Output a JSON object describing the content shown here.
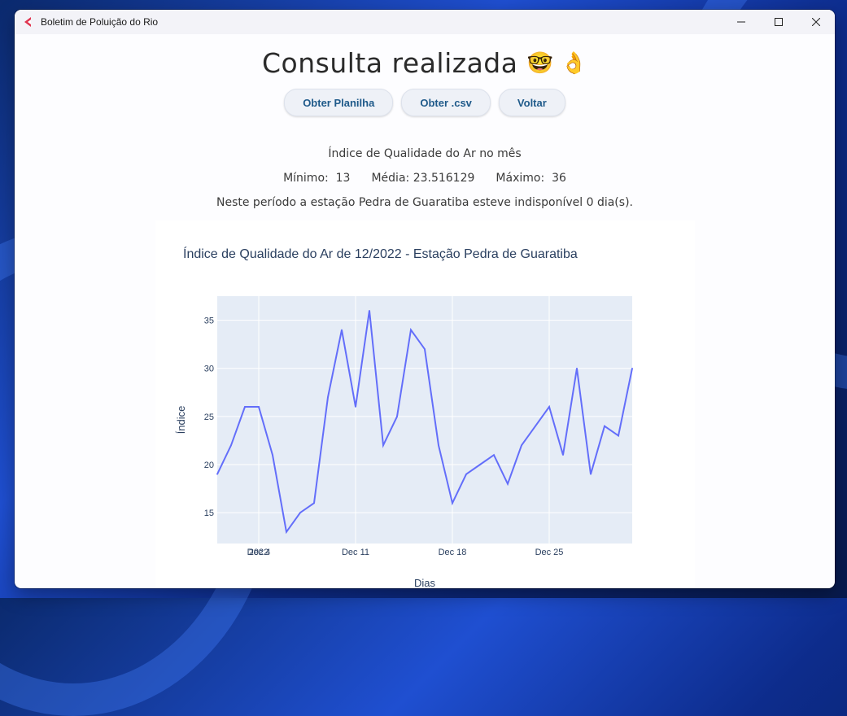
{
  "window": {
    "title": "Boletim de Poluição do Rio",
    "controls": [
      "minimize",
      "maximize",
      "close"
    ]
  },
  "page": {
    "heading": "Consulta realizada",
    "heading_emojis": "🤓 👌",
    "buttons": {
      "spreadsheet": "Obter Planilha",
      "csv": "Obter .csv",
      "back": "Voltar"
    },
    "subtitle": "Índice de Qualidade do Ar no mês",
    "stats": {
      "min_label": "Mínimo:",
      "min_value": "13",
      "avg_label": "Média:",
      "avg_value": "23.516129",
      "max_label": "Máximo:",
      "max_value": "36"
    },
    "unavailable_text": "Neste período a estação Pedra de Guaratiba esteve indisponível  0 dia(s)."
  },
  "chart_data": {
    "type": "line",
    "title": "Índice de Qualidade do Ar de 12/2022 - Estação Pedra de Guaratiba",
    "xlabel": "Dias",
    "ylabel": "Índice",
    "x": [
      "2022-12-01",
      "2022-12-02",
      "2022-12-03",
      "2022-12-04",
      "2022-12-05",
      "2022-12-06",
      "2022-12-07",
      "2022-12-08",
      "2022-12-09",
      "2022-12-10",
      "2022-12-11",
      "2022-12-12",
      "2022-12-13",
      "2022-12-14",
      "2022-12-15",
      "2022-12-16",
      "2022-12-17",
      "2022-12-18",
      "2022-12-19",
      "2022-12-20",
      "2022-12-21",
      "2022-12-22",
      "2022-12-23",
      "2022-12-24",
      "2022-12-25",
      "2022-12-26",
      "2022-12-27",
      "2022-12-28",
      "2022-12-29",
      "2022-12-30",
      "2022-12-31"
    ],
    "y": [
      19,
      22,
      26,
      26,
      21,
      13,
      15,
      16,
      27,
      34,
      26,
      36,
      22,
      25,
      34,
      32,
      22,
      16,
      19,
      20,
      21,
      18,
      22,
      24,
      26,
      21,
      30,
      19,
      24,
      23,
      30
    ],
    "ylim": [
      11.8,
      37.5
    ],
    "yticks": [
      15,
      20,
      25,
      30,
      35
    ],
    "xticks": [
      {
        "date": "2022-12-04",
        "label": "Dec 4",
        "sub": "2022"
      },
      {
        "date": "2022-12-11",
        "label": "Dec 11"
      },
      {
        "date": "2022-12-18",
        "label": "Dec 18"
      },
      {
        "date": "2022-12-25",
        "label": "Dec 25"
      }
    ],
    "grid": true,
    "line_color": "#636efa",
    "plot_bg": "#e5ecf6"
  },
  "colors": {
    "button_text": "#1f5a8a",
    "button_bg": "#eef1f7"
  }
}
